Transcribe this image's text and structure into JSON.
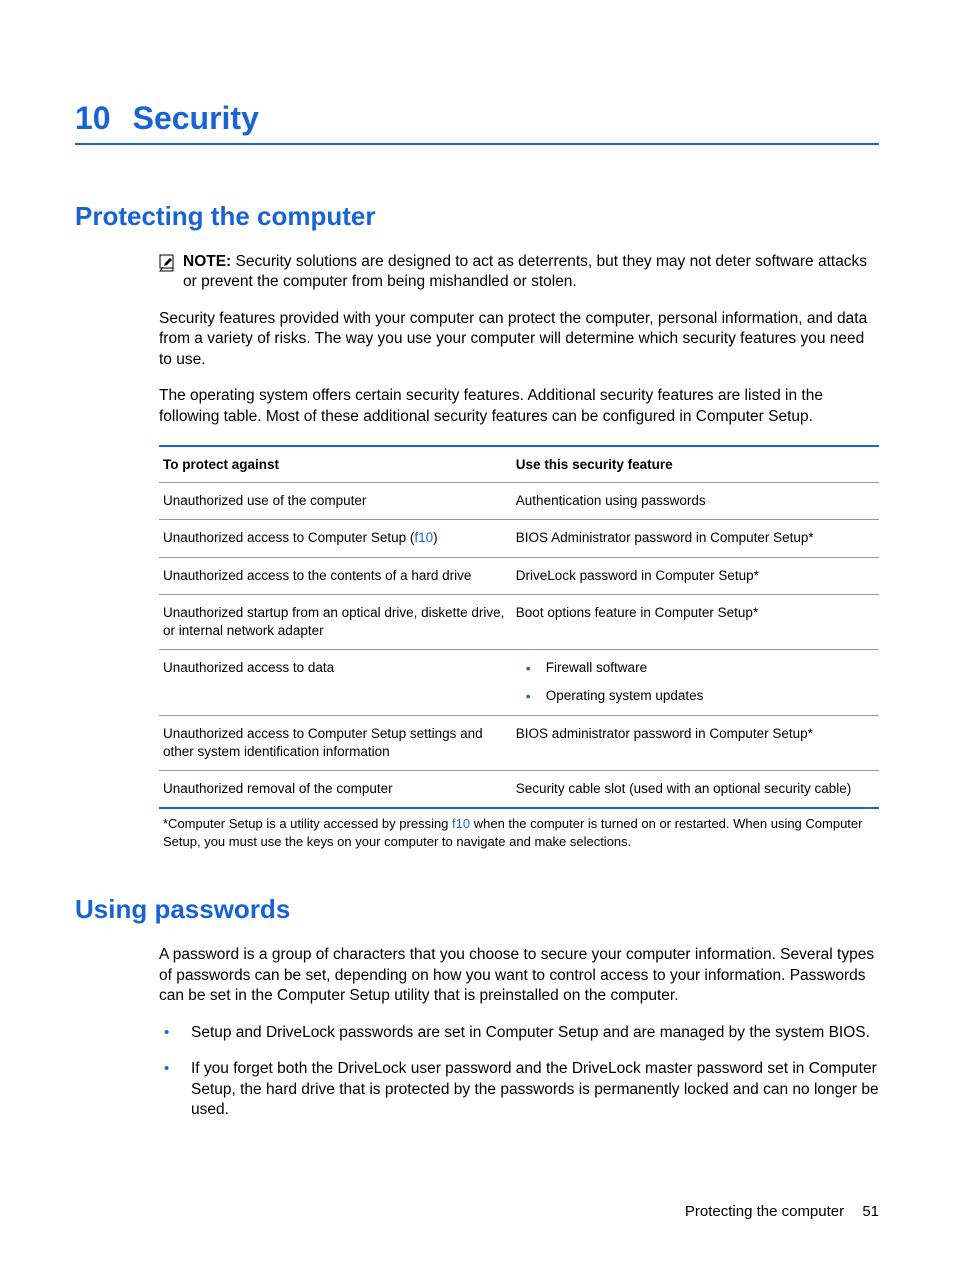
{
  "chapter": {
    "number": "10",
    "title": "Security"
  },
  "section1": {
    "heading": "Protecting the computer",
    "note_label": "NOTE:",
    "note_text": "Security solutions are designed to act as deterrents, but they may not deter software attacks or prevent the computer from being mishandled or stolen.",
    "para1": "Security features provided with your computer can protect the computer, personal information, and data from a variety of risks. The way you use your computer will determine which security features you need to use.",
    "para2": "The operating system offers certain security features. Additional security features are listed in the following table. Most of these additional security features can be configured in Computer Setup.",
    "table": {
      "header_col1": "To protect against",
      "header_col2": "Use this security feature",
      "rows": [
        {
          "c1": "Unauthorized use of the computer",
          "c2": "Authentication using passwords"
        },
        {
          "c1_pre": "Unauthorized access to Computer Setup (",
          "c1_link": "f10",
          "c1_post": ")",
          "c2": "BIOS Administrator password in Computer Setup*"
        },
        {
          "c1": "Unauthorized access to the contents of a hard drive",
          "c2": "DriveLock password in Computer Setup*"
        },
        {
          "c1": "Unauthorized startup from an optical drive, diskette drive, or internal network adapter",
          "c2": "Boot options feature in Computer Setup*"
        },
        {
          "c1": "Unauthorized access to data",
          "c2_list": [
            "Firewall software",
            "Operating system updates"
          ]
        },
        {
          "c1": "Unauthorized access to Computer Setup settings and other system identification information",
          "c2": "BIOS administrator password in Computer Setup*"
        },
        {
          "c1": "Unauthorized removal of the computer",
          "c2": "Security cable slot (used with an optional security cable)"
        }
      ],
      "footnote_pre": "*Computer Setup is a utility accessed by pressing ",
      "footnote_link": "f10",
      "footnote_post": " when the computer is turned on or restarted. When using Computer Setup, you must use the keys on your computer to navigate and make selections."
    }
  },
  "section2": {
    "heading": "Using passwords",
    "para1": "A password is a group of characters that you choose to secure your computer information. Several types of passwords can be set, depending on how you want to control access to your information. Passwords can be set in the Computer Setup utility that is preinstalled on the computer.",
    "list": [
      "Setup and DriveLock passwords are set in Computer Setup and are managed by the system BIOS.",
      "If you forget both the DriveLock user password and the DriveLock master password set in Computer Setup, the hard drive that is protected by the passwords is permanently locked and can no longer be used."
    ]
  },
  "footer": {
    "text": "Protecting the computer",
    "page": "51"
  }
}
